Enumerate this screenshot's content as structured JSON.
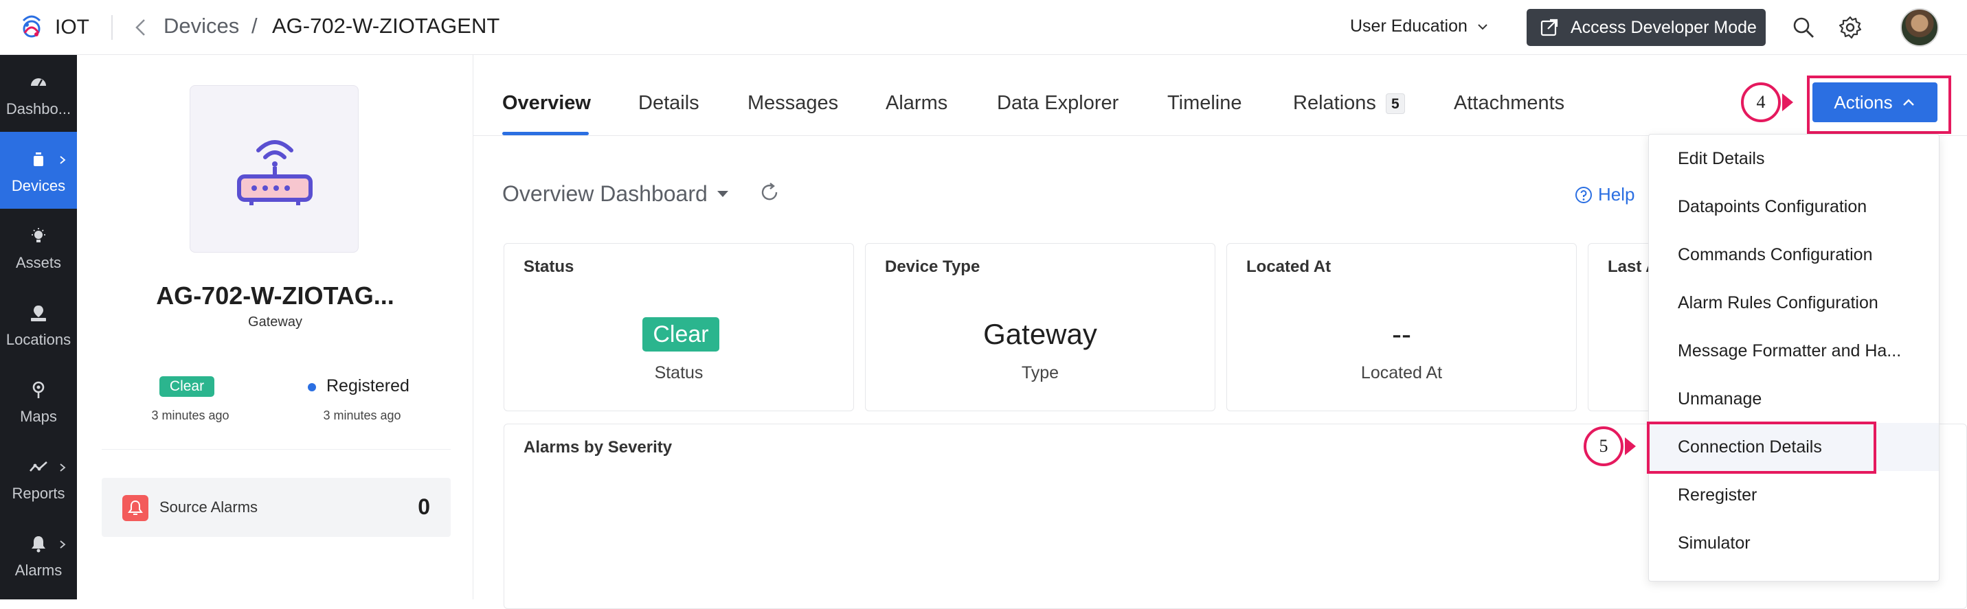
{
  "header": {
    "brand": "IOT",
    "breadcrumb_parent": "Devices",
    "breadcrumb_separator": "/",
    "breadcrumb_current": "AG-702-W-ZIOTAGENT",
    "org_selector": "User Education",
    "developer_mode_label": "Access Developer Mode"
  },
  "sidebar": {
    "items": [
      {
        "label": "Dashbo...",
        "icon": "dashboard-icon"
      },
      {
        "label": "Devices",
        "icon": "device-icon",
        "active": true
      },
      {
        "label": "Assets",
        "icon": "asset-icon"
      },
      {
        "label": "Locations",
        "icon": "location-icon"
      },
      {
        "label": "Maps",
        "icon": "map-pin-icon"
      },
      {
        "label": "Reports",
        "icon": "reports-icon"
      },
      {
        "label": "Alarms",
        "icon": "bell-icon"
      }
    ]
  },
  "device": {
    "name": "AG-702-W-ZIOTAG...",
    "type": "Gateway",
    "status_badge": "Clear",
    "status_time": "3 minutes ago",
    "registration": "Registered",
    "registration_time": "3 minutes ago",
    "source_alarms_label": "Source Alarms",
    "source_alarms_count": "0"
  },
  "tabs": [
    {
      "label": "Overview",
      "active": true
    },
    {
      "label": "Details"
    },
    {
      "label": "Messages"
    },
    {
      "label": "Alarms"
    },
    {
      "label": "Data Explorer"
    },
    {
      "label": "Timeline"
    },
    {
      "label": "Relations",
      "count": "5"
    },
    {
      "label": "Attachments"
    }
  ],
  "actions_label": "Actions",
  "overview": {
    "title": "Overview Dashboard",
    "help": "Help",
    "cards": [
      {
        "title": "Status",
        "value": "Clear",
        "sub": "Status"
      },
      {
        "title": "Device Type",
        "value": "Gateway",
        "sub": "Type"
      },
      {
        "title": "Located At",
        "value": "--",
        "sub": "Located At"
      },
      {
        "title": "Last A",
        "value": "",
        "sub": ""
      }
    ],
    "alarms_title": "Alarms by Severity"
  },
  "actions_menu": [
    "Edit Details",
    "Datapoints Configuration",
    "Commands Configuration",
    "Alarm Rules Configuration",
    "Message Formatter and Ha...",
    "Unmanage",
    "Connection Details",
    "Reregister",
    "Simulator"
  ],
  "annotations": {
    "step_4": "4",
    "step_5": "5"
  },
  "colors": {
    "primary": "#2b6fe2",
    "sidebar_bg": "#1b1d22",
    "success": "#2bb58e",
    "annotation": "#e5195e",
    "alert": "#f35b5b"
  }
}
